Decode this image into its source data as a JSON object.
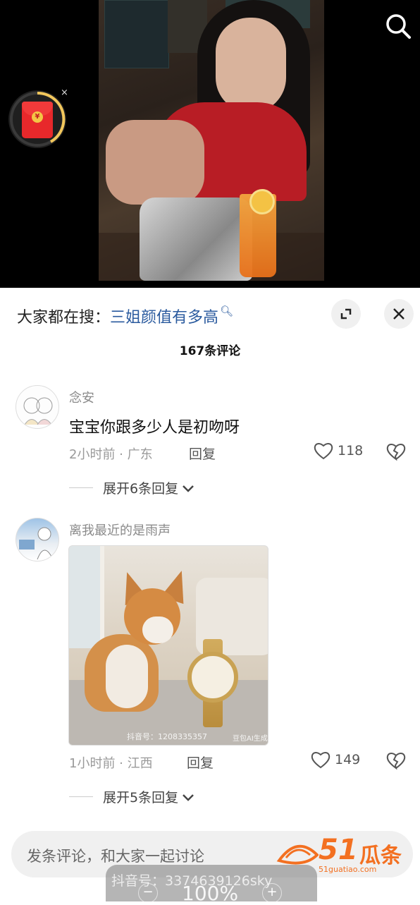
{
  "suggest": {
    "prefix": "大家都在搜：",
    "keyword": "三姐颜值有多高"
  },
  "comments_count": "167条评论",
  "comments": [
    {
      "user": "念安",
      "text": "宝宝你跟多少人是初吻呀",
      "time_location": "2小时前 · 广东",
      "reply": "回复",
      "likes": "118",
      "expand": "展开6条回复"
    },
    {
      "user": "离我最近的是雨声",
      "time_location": "1小时前 · 江西",
      "reply": "回复",
      "likes": "149",
      "expand": "展开5条回复",
      "image": {
        "watermark": "抖音号：1208335357",
        "ai_tag": "豆包AI生成"
      }
    }
  ],
  "redpacket": {
    "coin": "¥",
    "close": "×"
  },
  "input": {
    "placeholder": "发条评论，和大家一起讨论"
  },
  "watermark": {
    "logo_num": "51",
    "logo_zh": "瓜条",
    "site": "51guatiao.com"
  },
  "zoom_overlay": {
    "douyin": "抖音号：3374639126sky",
    "zoom": "100%",
    "minus": "−",
    "plus": "+"
  },
  "colors": {
    "keyword": "#2a5a9e",
    "accent_orange": "#f37021",
    "redpacket": "#e8282b"
  }
}
